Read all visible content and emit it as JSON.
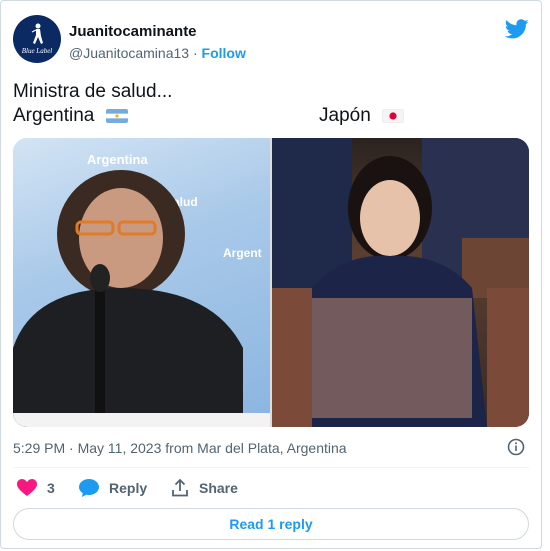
{
  "tweet": {
    "author_name": "Juanitocaminante",
    "author_handle": "@Juanitocamina13",
    "separator": "·",
    "follow_label": "Follow",
    "avatar_brand": "Blue Label",
    "text_line1": "Ministra de salud...",
    "text_line2_left": "Argentina",
    "text_line2_right": "Japón",
    "timestamp": "5:29 PM · May 11, 2023 from Mar del Plata, Argentina",
    "like_count": "3",
    "reply_label": "Reply",
    "share_label": "Share",
    "read_replies_label": "Read 1 reply"
  },
  "media": {
    "left_banner_text": "Argentina",
    "left_banner_text2": "Salud",
    "left_banner_text3": "Argent"
  },
  "icons": {
    "brand_bird": "twitter-bird-icon",
    "info": "info-icon",
    "like": "heart-icon",
    "reply": "speech-bubble-icon",
    "share": "share-icon"
  },
  "colors": {
    "accent": "#1d9bf0",
    "heart": "#f91880",
    "muted_text": "#536471",
    "border": "#cfd9de"
  }
}
